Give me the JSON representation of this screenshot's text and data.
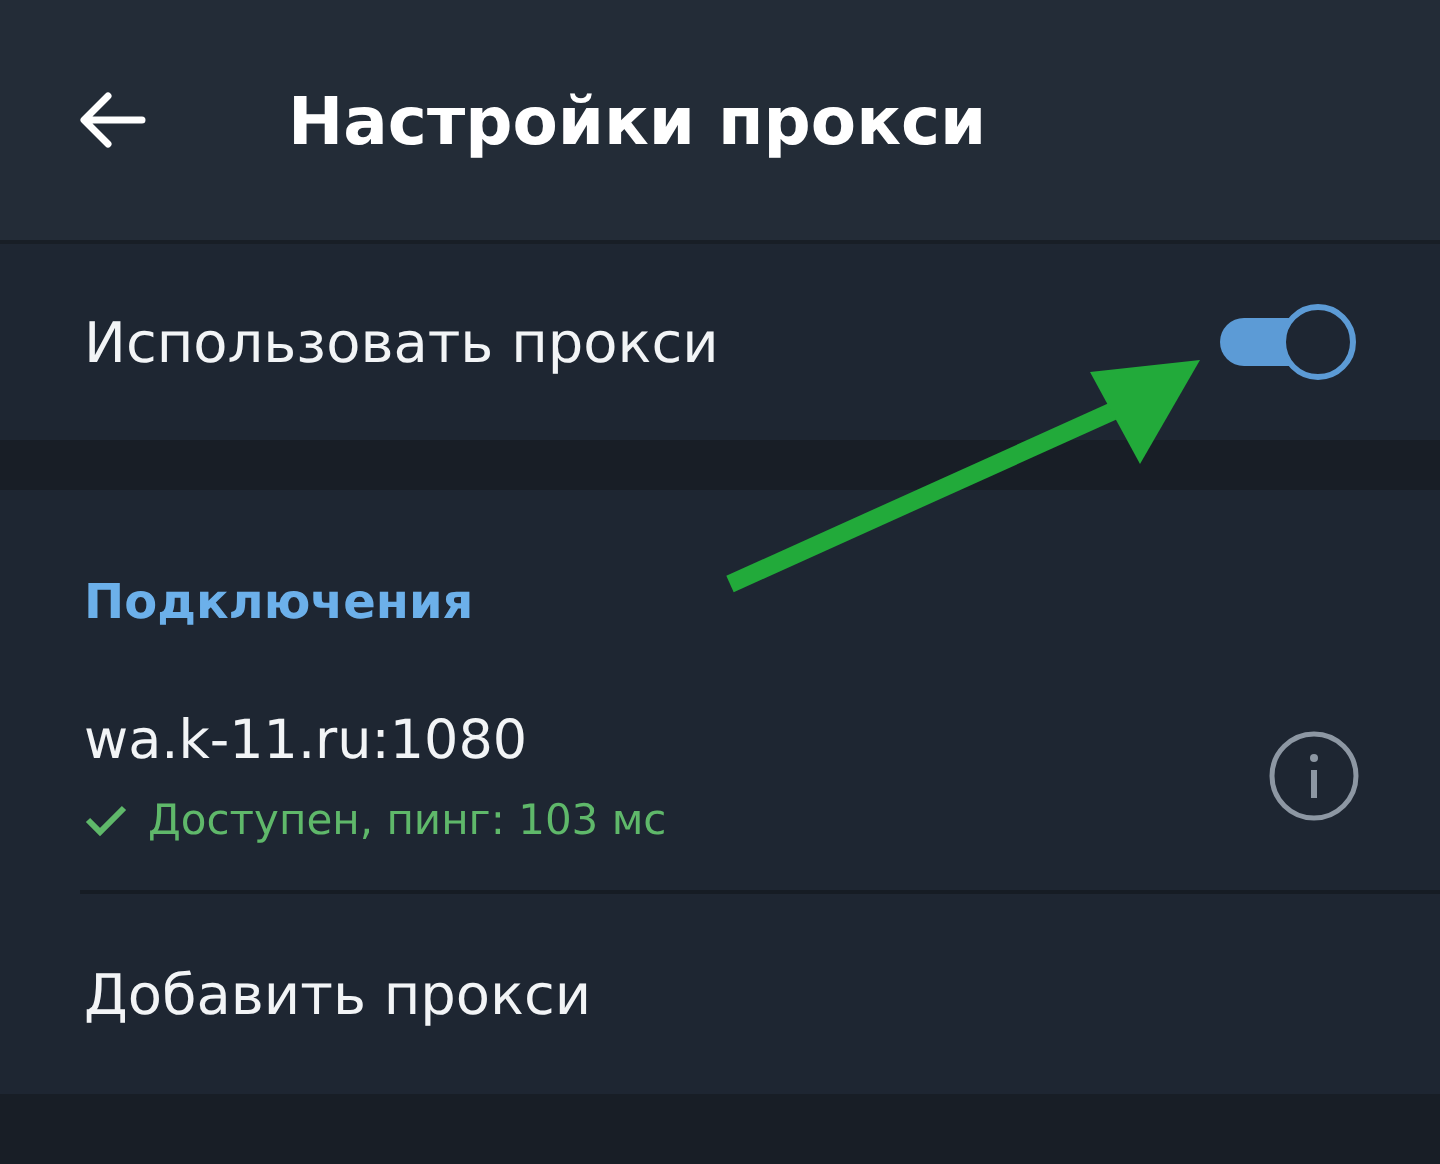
{
  "header": {
    "title": "Настройки прокси"
  },
  "use_proxy": {
    "label": "Использовать прокси",
    "on": true
  },
  "connections": {
    "heading": "Подключения",
    "proxies": [
      {
        "address": "wa.k-11.ru:1080",
        "status": "Доступен, пинг: 103 мс",
        "available": true
      }
    ],
    "add_label": "Добавить прокси"
  }
}
